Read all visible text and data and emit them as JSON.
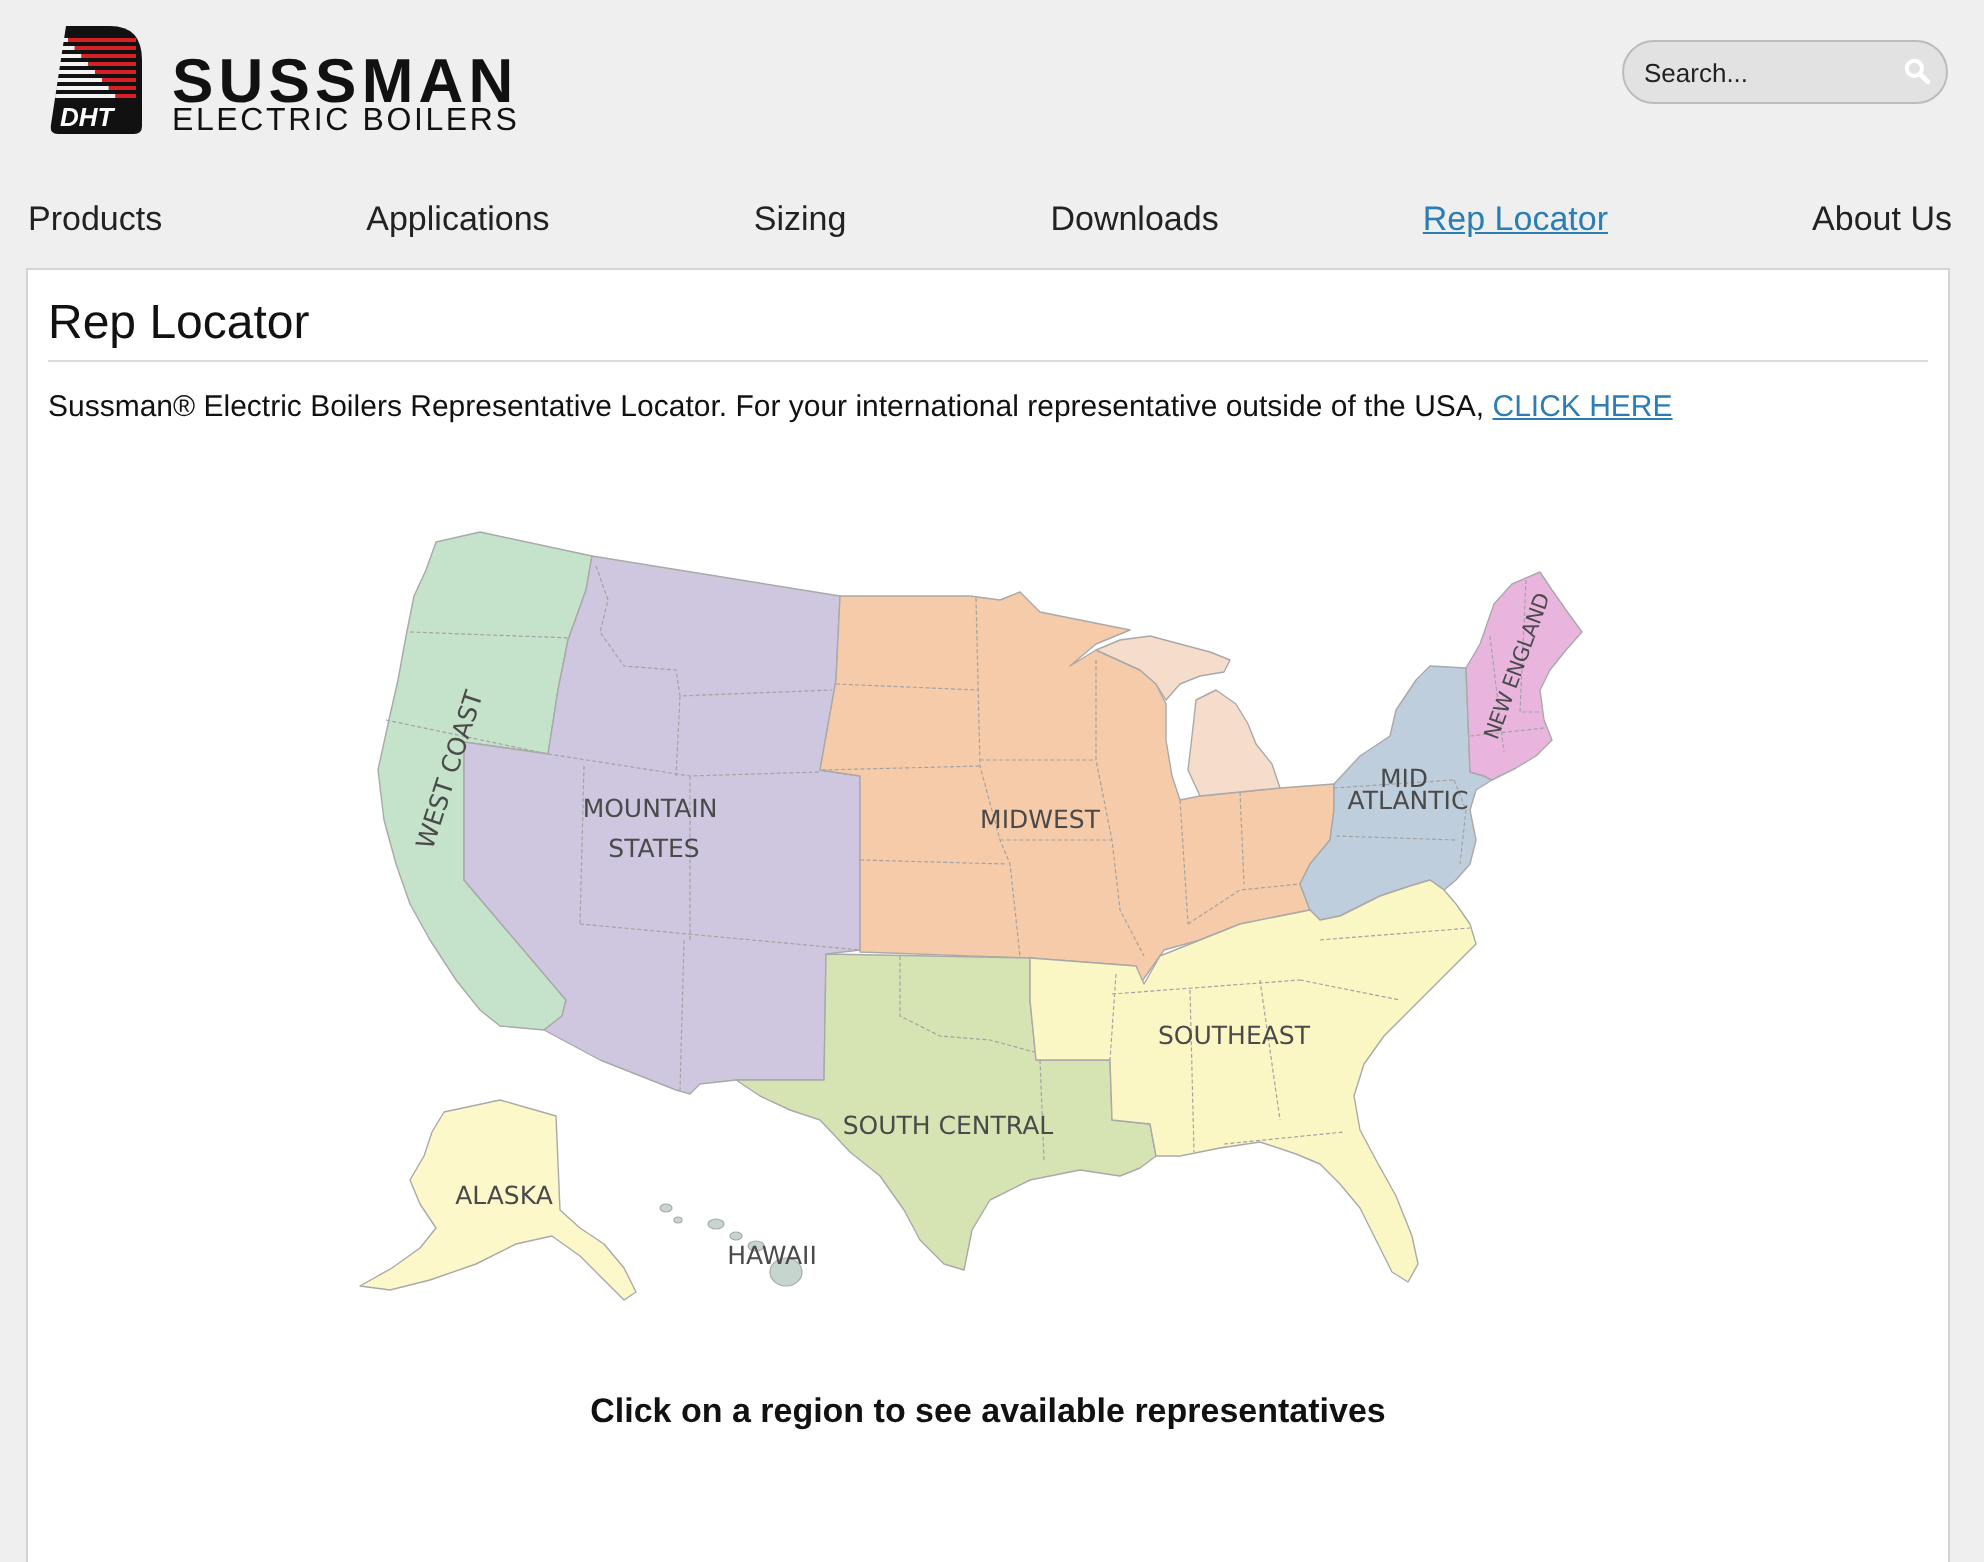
{
  "header": {
    "logo": {
      "initials": "DHT",
      "name": "SUSSMAN",
      "tagline": "ELECTRIC BOILERS"
    },
    "search": {
      "placeholder": "Search..."
    }
  },
  "nav": [
    {
      "label": "Products",
      "selected": false
    },
    {
      "label": "Applications",
      "selected": false
    },
    {
      "label": "Sizing",
      "selected": false
    },
    {
      "label": "Downloads",
      "selected": false
    },
    {
      "label": "Rep Locator",
      "selected": true
    },
    {
      "label": "About Us",
      "selected": false
    }
  ],
  "panel": {
    "title": "Rep Locator",
    "intro": "Sussman® Electric Boilers Representative Locator. For your international representative outside of the USA,",
    "intro_link": "CLICK HERE",
    "map": {
      "regions": [
        {
          "label": "WEST COAST",
          "color": "#c5e2ca"
        },
        {
          "label": "MOUNTAIN STATES",
          "color": "#cfc7df"
        },
        {
          "label": "MIDWEST",
          "color": "#f6cba9"
        },
        {
          "color": "#f6dccb"
        },
        {
          "label": "MID ATLANTIC",
          "color": "#bfcedc"
        },
        {
          "label": "NEW ENGLAND",
          "color": "#e9b5de"
        },
        {
          "label": "SOUTH CENTRAL",
          "color": "#d6e4b4"
        },
        {
          "label": "SOUTHEAST",
          "color": "#fbf7c5"
        },
        {
          "label": "ALASKA",
          "color": "#fcf8c9"
        },
        {
          "label": "HAWAII",
          "color": "#c6d5cd"
        }
      ]
    },
    "caption": "Click on a region to see available representatives"
  }
}
